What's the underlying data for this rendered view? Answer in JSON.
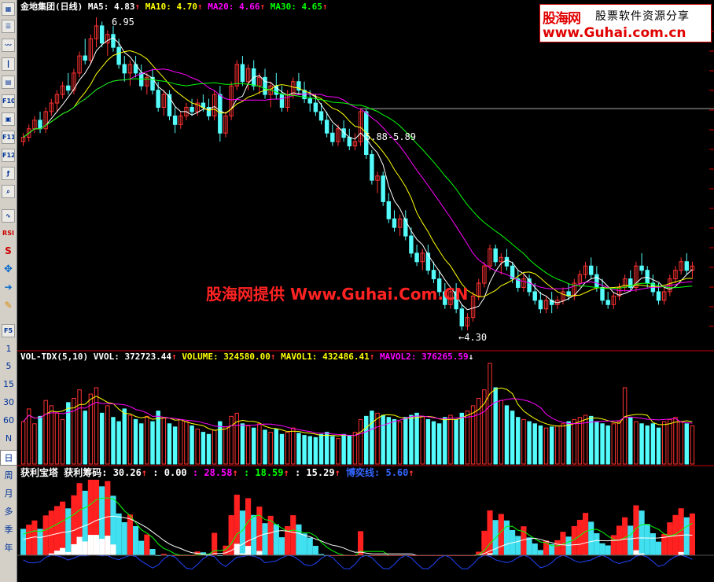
{
  "toolbar": {
    "icons": [
      "grid-icon",
      "table-icon",
      "line-chart-icon",
      "candle-icon",
      "book-icon",
      "f10-icon",
      "calc-icon",
      "f11-icon",
      "f12-icon",
      "formula-icon",
      "zoom-icon",
      "wave-icon",
      "rsi-icon",
      "s-icon",
      "move-icon",
      "export-icon",
      "pencil-icon",
      "f5-icon"
    ],
    "labels": {
      "f10": "F10",
      "f11": "F11",
      "f12": "F12",
      "rsi": "RSI",
      "f5": "F5",
      "s": "S"
    },
    "periods": [
      "1",
      "5",
      "15",
      "30",
      "60",
      "N",
      "日",
      "周",
      "月",
      "多",
      "季",
      "年"
    ],
    "active_period": "日"
  },
  "price_panel": {
    "stock": "金地集团",
    "period_label": "(日线)",
    "ma5": "MA5: 4.83",
    "ma10": "MA10: 4.70",
    "ma20": "MA20: 4.66",
    "ma30": "MA30: 4.65",
    "arrow": "↑",
    "high_label": "6.95",
    "low_label": "←4.30",
    "range_label": "5.88-5.89"
  },
  "volume_panel": {
    "name": "VOL-TDX(5,10)",
    "vvol": "VVOL: 372723.44",
    "volume": "VOLUME: 324580.00",
    "mavol1": "MAVOL1: 432486.41",
    "mavol2": "MAVOL2: 376265.59",
    "up_arrow": "↑",
    "down_arrow": "↓"
  },
  "profit_panel": {
    "name": "获利宝塔",
    "chip": "获利筹码: 30.26",
    "v1": ": 0.00",
    "v2": ": 28.58",
    "v3": ": 18.59",
    "v4": ": 15.29",
    "v5": "博奕线: 5.60",
    "arrow": "↑"
  },
  "logo": {
    "name": "股海网",
    "slogan": "股票软件资源分享",
    "url": "www.Guhai.com.cn"
  },
  "watermark": "股海网提供 Www.Guhai.Com.CN",
  "colors": {
    "up": "#ff3232",
    "down": "#54fcfc",
    "ma5": "#ffffff",
    "ma10": "#ffff00",
    "ma20": "#ff00ff",
    "ma30": "#00ff00",
    "divider": "#c00000"
  },
  "chart_data": {
    "type": "candlestick",
    "title": "金地集团 (日线)",
    "candle_count": 120,
    "ohlc": [
      [
        5.5,
        5.6,
        5.45,
        5.55
      ],
      [
        5.55,
        5.7,
        5.5,
        5.65
      ],
      [
        5.65,
        5.8,
        5.6,
        5.75
      ],
      [
        5.75,
        5.85,
        5.6,
        5.65
      ],
      [
        5.65,
        5.9,
        5.6,
        5.85
      ],
      [
        5.85,
        6.0,
        5.8,
        5.95
      ],
      [
        5.95,
        6.1,
        5.85,
        6.05
      ],
      [
        6.05,
        6.2,
        6.0,
        6.15
      ],
      [
        6.15,
        6.3,
        6.05,
        6.1
      ],
      [
        6.1,
        6.35,
        6.05,
        6.3
      ],
      [
        6.3,
        6.55,
        6.25,
        6.5
      ],
      [
        6.5,
        6.7,
        6.4,
        6.45
      ],
      [
        6.45,
        6.75,
        6.4,
        6.7
      ],
      [
        6.7,
        6.95,
        6.6,
        6.85
      ],
      [
        6.85,
        6.9,
        6.6,
        6.65
      ],
      [
        6.65,
        6.8,
        6.5,
        6.75
      ],
      [
        6.75,
        6.85,
        6.55,
        6.6
      ],
      [
        6.6,
        6.7,
        6.35,
        6.4
      ],
      [
        6.4,
        6.5,
        6.2,
        6.3
      ],
      [
        6.3,
        6.45,
        6.15,
        6.4
      ],
      [
        6.4,
        6.5,
        6.25,
        6.3
      ],
      [
        6.3,
        6.4,
        6.1,
        6.15
      ],
      [
        6.15,
        6.3,
        6.05,
        6.25
      ],
      [
        6.25,
        6.35,
        6.05,
        6.1
      ],
      [
        6.1,
        6.2,
        5.85,
        5.9
      ],
      [
        5.9,
        6.1,
        5.8,
        6.05
      ],
      [
        6.05,
        6.1,
        5.75,
        5.8
      ],
      [
        5.8,
        5.9,
        5.6,
        5.7
      ],
      [
        5.7,
        5.85,
        5.65,
        5.8
      ],
      [
        5.8,
        5.95,
        5.75,
        5.9
      ],
      [
        5.9,
        6.0,
        5.8,
        5.85
      ],
      [
        5.85,
        6.0,
        5.8,
        5.95
      ],
      [
        5.95,
        6.05,
        5.85,
        5.9
      ],
      [
        5.9,
        6.0,
        5.75,
        5.8
      ],
      [
        5.8,
        6.1,
        5.75,
        6.05
      ],
      [
        6.05,
        6.15,
        5.5,
        5.6
      ],
      [
        5.6,
        5.85,
        5.55,
        5.8
      ],
      [
        5.8,
        6.2,
        5.75,
        6.15
      ],
      [
        6.15,
        6.45,
        6.1,
        6.4
      ],
      [
        6.4,
        6.5,
        6.15,
        6.2
      ],
      [
        6.2,
        6.4,
        6.1,
        6.35
      ],
      [
        6.35,
        6.45,
        6.1,
        6.15
      ],
      [
        6.15,
        6.3,
        6.05,
        6.25
      ],
      [
        6.25,
        6.35,
        6.0,
        6.05
      ],
      [
        6.05,
        6.2,
        5.9,
        6.15
      ],
      [
        6.15,
        6.3,
        6.0,
        6.05
      ],
      [
        6.05,
        6.15,
        5.85,
        5.9
      ],
      [
        5.9,
        6.1,
        5.85,
        6.05
      ],
      [
        6.05,
        6.25,
        6.0,
        6.2
      ],
      [
        6.2,
        6.3,
        6.05,
        6.1
      ],
      [
        6.1,
        6.2,
        5.95,
        6.0
      ],
      [
        6.0,
        6.1,
        5.85,
        5.95
      ],
      [
        5.95,
        6.05,
        5.8,
        5.85
      ],
      [
        5.85,
        5.95,
        5.7,
        5.75
      ],
      [
        5.75,
        5.85,
        5.55,
        5.6
      ],
      [
        5.6,
        5.7,
        5.45,
        5.5
      ],
      [
        5.5,
        5.7,
        5.45,
        5.65
      ],
      [
        5.65,
        5.75,
        5.5,
        5.55
      ],
      [
        5.55,
        5.65,
        5.4,
        5.45
      ],
      [
        5.45,
        5.6,
        5.4,
        5.5
      ],
      [
        5.5,
        5.89,
        5.45,
        5.85
      ],
      [
        5.85,
        5.88,
        5.3,
        5.35
      ],
      [
        5.35,
        5.4,
        5.0,
        5.05
      ],
      [
        5.05,
        5.15,
        4.9,
        5.1
      ],
      [
        5.1,
        5.15,
        4.75,
        4.8
      ],
      [
        4.8,
        4.9,
        4.55,
        4.6
      ],
      [
        4.6,
        4.7,
        4.45,
        4.5
      ],
      [
        4.5,
        4.65,
        4.4,
        4.6
      ],
      [
        4.6,
        4.7,
        4.35,
        4.4
      ],
      [
        4.4,
        4.5,
        4.15,
        4.2
      ],
      [
        4.2,
        4.3,
        4.05,
        4.1
      ],
      [
        4.1,
        4.25,
        4.0,
        4.2
      ],
      [
        4.2,
        4.3,
        3.95,
        4.0
      ],
      [
        4.0,
        4.1,
        3.85,
        3.9
      ],
      [
        3.9,
        4.0,
        3.7,
        3.75
      ],
      [
        3.75,
        3.85,
        3.55,
        3.6
      ],
      [
        3.6,
        3.8,
        3.55,
        3.75
      ],
      [
        3.75,
        3.85,
        3.5,
        3.55
      ],
      [
        3.55,
        3.6,
        3.3,
        3.35
      ],
      [
        3.35,
        3.5,
        3.3,
        3.45
      ],
      [
        3.45,
        3.75,
        3.4,
        3.7
      ],
      [
        3.7,
        3.9,
        3.65,
        3.85
      ],
      [
        3.85,
        4.1,
        3.8,
        4.05
      ],
      [
        4.05,
        4.3,
        4.0,
        4.25
      ],
      [
        4.25,
        4.3,
        4.05,
        4.1
      ],
      [
        4.1,
        4.2,
        3.95,
        4.15
      ],
      [
        4.15,
        4.25,
        4.0,
        4.05
      ],
      [
        4.05,
        4.1,
        3.85,
        3.9
      ],
      [
        3.9,
        4.0,
        3.75,
        3.8
      ],
      [
        3.8,
        3.95,
        3.75,
        3.9
      ],
      [
        3.9,
        3.95,
        3.7,
        3.75
      ],
      [
        3.75,
        3.85,
        3.6,
        3.65
      ],
      [
        3.65,
        3.75,
        3.5,
        3.55
      ],
      [
        3.55,
        3.7,
        3.5,
        3.65
      ],
      [
        3.65,
        3.75,
        3.5,
        3.6
      ],
      [
        3.6,
        3.7,
        3.55,
        3.65
      ],
      [
        3.65,
        3.8,
        3.6,
        3.75
      ],
      [
        3.75,
        3.85,
        3.65,
        3.7
      ],
      [
        3.7,
        3.9,
        3.65,
        3.85
      ],
      [
        3.85,
        4.0,
        3.8,
        3.95
      ],
      [
        3.95,
        4.1,
        3.9,
        4.05
      ],
      [
        4.05,
        4.15,
        3.9,
        3.95
      ],
      [
        3.95,
        4.05,
        3.75,
        3.8
      ],
      [
        3.8,
        3.9,
        3.6,
        3.65
      ],
      [
        3.65,
        3.75,
        3.55,
        3.6
      ],
      [
        3.6,
        3.75,
        3.55,
        3.7
      ],
      [
        3.7,
        3.85,
        3.65,
        3.8
      ],
      [
        3.8,
        3.95,
        3.75,
        3.9
      ],
      [
        3.9,
        4.0,
        3.75,
        3.8
      ],
      [
        3.8,
        4.1,
        3.75,
        4.05
      ],
      [
        4.05,
        4.2,
        3.95,
        4.0
      ],
      [
        4.0,
        4.05,
        3.8,
        3.85
      ],
      [
        3.85,
        3.95,
        3.7,
        3.75
      ],
      [
        3.75,
        3.85,
        3.6,
        3.65
      ],
      [
        3.65,
        3.8,
        3.6,
        3.75
      ],
      [
        3.75,
        3.95,
        3.7,
        3.9
      ],
      [
        3.9,
        4.05,
        3.85,
        4.0
      ],
      [
        4.0,
        4.15,
        3.95,
        4.1
      ],
      [
        4.1,
        4.2,
        3.95,
        4.0
      ],
      [
        4.0,
        4.1,
        3.9,
        4.05
      ]
    ],
    "volume": [
      40,
      52,
      38,
      45,
      60,
      55,
      48,
      42,
      58,
      62,
      70,
      50,
      66,
      72,
      48,
      55,
      44,
      40,
      52,
      46,
      42,
      38,
      45,
      40,
      50,
      44,
      38,
      35,
      42,
      40,
      36,
      33,
      30,
      28,
      32,
      40,
      35,
      45,
      48,
      38,
      36,
      34,
      38,
      32,
      30,
      33,
      28,
      30,
      34,
      29,
      27,
      26,
      25,
      28,
      30,
      26,
      24,
      28,
      27,
      30,
      42,
      45,
      50,
      48,
      46,
      44,
      42,
      40,
      44,
      46,
      48,
      45,
      42,
      40,
      38,
      44,
      46,
      42,
      48,
      50,
      55,
      62,
      70,
      95,
      72,
      60,
      55,
      50,
      44,
      42,
      40,
      38,
      36,
      34,
      35,
      36,
      38,
      40,
      42,
      44,
      46,
      45,
      40,
      38,
      36,
      38,
      40,
      72,
      44,
      40,
      38,
      36,
      38,
      34,
      40,
      42,
      44,
      40,
      38,
      36
    ],
    "volume_unit_note": "",
    "ylim": [
      3.3,
      6.95
    ]
  }
}
